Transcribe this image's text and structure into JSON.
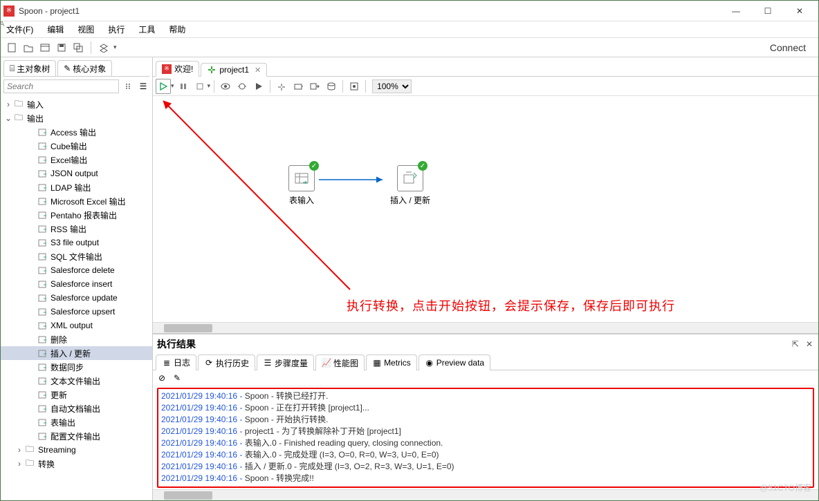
{
  "window": {
    "title": "Spoon - project1"
  },
  "menu": {
    "file": "文件(F)",
    "edit": "编辑",
    "view": "视图",
    "run": "执行",
    "tools": "工具",
    "help": "帮助"
  },
  "toolbar": {
    "connect": "Connect"
  },
  "sidebar": {
    "tabs": {
      "objectTree": "主对象树",
      "coreObjects": "核心对象"
    },
    "search_placeholder": "Search",
    "tree": {
      "input": "输入",
      "output": "输出",
      "items": [
        "Access 输出",
        "Cube输出",
        "Excel输出",
        "JSON output",
        "LDAP 输出",
        "Microsoft Excel 输出",
        "Pentaho 报表输出",
        "RSS 输出",
        "S3 file output",
        "SQL 文件输出",
        "Salesforce delete",
        "Salesforce insert",
        "Salesforce update",
        "Salesforce upsert",
        "XML output",
        "删除",
        "插入 / 更新",
        "数据同步",
        "文本文件输出",
        "更新",
        "自动文档输出",
        "表输出",
        "配置文件输出"
      ],
      "selected_index": 16,
      "streaming": "Streaming",
      "transform": "转换"
    }
  },
  "editor": {
    "tabs": {
      "welcome": "欢迎!",
      "project": "project1"
    },
    "zoom": "100%",
    "steps": {
      "table_input": "表输入",
      "insert_update": "插入 / 更新"
    },
    "annotation": "执行转换，点击开始按钮，会提示保存，保存后即可执行"
  },
  "results": {
    "title": "执行结果",
    "tabs": {
      "log": "日志",
      "history": "执行历史",
      "step_metrics": "步骤度量",
      "perf": "性能图",
      "metrics": "Metrics",
      "preview": "Preview data"
    },
    "log": [
      {
        "ts": "2021/01/29 19:40:16",
        "msg": "Spoon - 转换已经打开."
      },
      {
        "ts": "2021/01/29 19:40:16",
        "msg": "Spoon - 正在打开转换 [project1]..."
      },
      {
        "ts": "2021/01/29 19:40:16",
        "msg": "Spoon - 开始执行转换."
      },
      {
        "ts": "2021/01/29 19:40:16",
        "msg": "project1 - 为了转换解除补丁开始  [project1]"
      },
      {
        "ts": "2021/01/29 19:40:16",
        "msg": "表输入.0 - Finished reading query, closing connection."
      },
      {
        "ts": "2021/01/29 19:40:16",
        "msg": "表输入.0 - 完成处理 (I=3, O=0, R=0, W=3, U=0, E=0)"
      },
      {
        "ts": "2021/01/29 19:40:16",
        "msg": "插入 / 更新.0 - 完成处理 (I=3, O=2, R=3, W=3, U=1, E=0)"
      },
      {
        "ts": "2021/01/29 19:40:16",
        "msg": "Spoon - 转换完成!!"
      }
    ]
  },
  "watermark": "@51CTO博客"
}
